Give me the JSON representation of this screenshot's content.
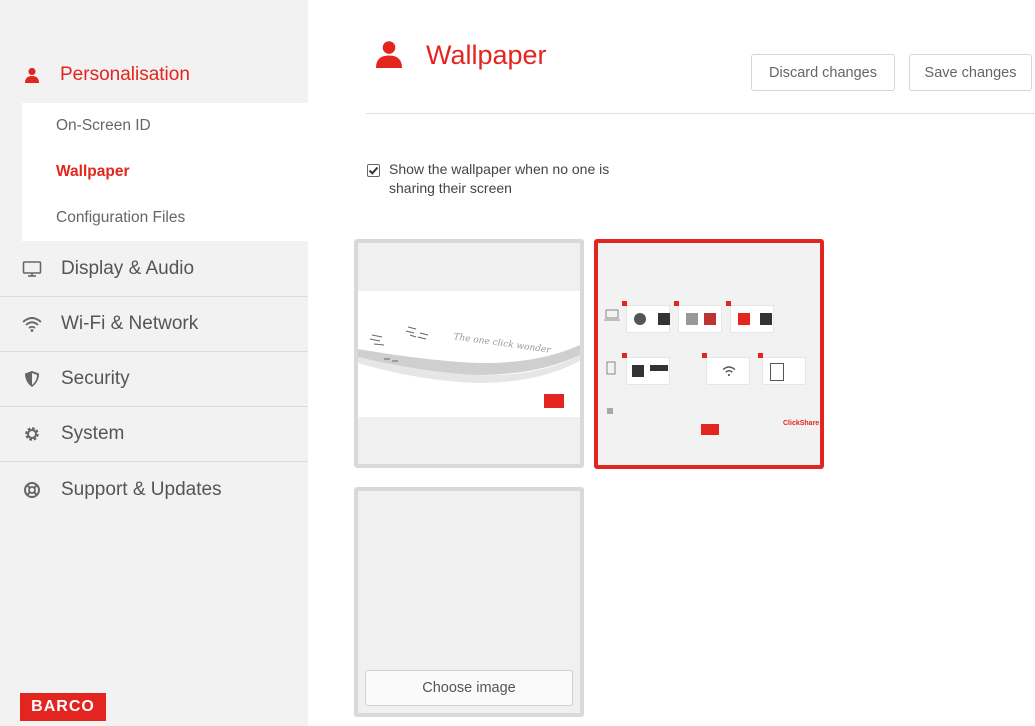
{
  "sidebar": {
    "section_label": "Personalisation",
    "sub_items": [
      "On-Screen ID",
      "Wallpaper",
      "Configuration Files"
    ],
    "active_sub_item": "Wallpaper",
    "nav_items": [
      {
        "label": "Display & Audio",
        "icon": "monitor-icon"
      },
      {
        "label": "Wi-Fi & Network",
        "icon": "wifi-icon"
      },
      {
        "label": "Security",
        "icon": "shield-icon"
      },
      {
        "label": "System",
        "icon": "gear-icon"
      },
      {
        "label": "Support & Updates",
        "icon": "lifebuoy-icon"
      }
    ],
    "logo_text": "BARCO"
  },
  "main": {
    "title": "Wallpaper",
    "title_icon": "person-icon",
    "discard_label": "Discard changes",
    "save_label": "Save changes",
    "checkbox_label": "Show the wallpaper when no one is sharing their screen",
    "checkbox_checked": true,
    "wallpaper_1_text": "The one click wonder",
    "wallpaper_2_brand": "ClickShare",
    "choose_image_label": "Choose image"
  },
  "colors": {
    "accent": "#e3251f",
    "sidebar_bg": "#f2f2f2",
    "selected_border": "#e3251f"
  }
}
